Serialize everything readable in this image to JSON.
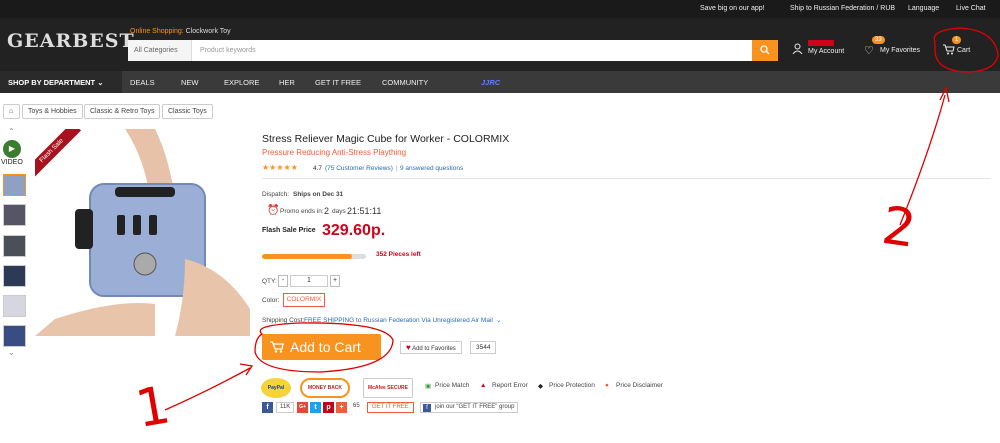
{
  "topbar": {
    "app_promo": "Save big on our app!",
    "ship_to": "Ship to Russian Federation / RUB",
    "language": "Language",
    "live_chat": "Live Chat"
  },
  "header": {
    "logo": "GEARBEST",
    "online_label": "Online Shopping:",
    "online_value": "Clockwork Toy",
    "category_select": "All Categories",
    "search_placeholder": "Product keywords",
    "account": "My Account",
    "favorites": "My Favorites",
    "favorites_count": "33",
    "cart": "Cart",
    "cart_count": "1"
  },
  "nav": {
    "department": "SHOP BY DEPARTMENT",
    "items": [
      "DEALS",
      "NEW",
      "EXPLORE",
      "HER",
      "GET IT FREE",
      "COMMUNITY"
    ],
    "brand": "JJRC"
  },
  "breadcrumb": [
    "Toys & Hobbies",
    "Classic & Retro Toys",
    "Classic Toys"
  ],
  "gallery": {
    "video_label": "VIDEO",
    "ribbon": "Flash Sale"
  },
  "product": {
    "title": "Stress Reliever Magic Cube for Worker  -  COLORMIX",
    "subtitle": "Pressure Reducing Anti-Stress Plaything",
    "rating": "4.7",
    "reviews": "(75 Customer Reviews)",
    "questions": "9 answered questions",
    "dispatch_label": "Dispatch:",
    "dispatch_value": "Ships on Dec 31",
    "promo_label": "Promo ends in:",
    "promo_days": "2",
    "promo_days_unit": "days",
    "promo_time": "21:51:11",
    "flash_label": "Flash Sale Price",
    "price": "329.60p.",
    "pieces_left": "352 Pieces left",
    "stock_fraction": 0.87,
    "qty_label": "QTY:",
    "qty_value": "1",
    "color_label": "Color:",
    "color_value": "COLORMIX",
    "shipping_label": "Shipping Cost:",
    "shipping_value": "FREE SHIPPING to Russian Federation Via Unregistered Air Mail",
    "add_to_cart": "Add to Cart",
    "add_to_favorites": "Add to Favorites",
    "favorites_count": "3544"
  },
  "trust": {
    "badges": [
      "PayPal",
      "MONEY BACK",
      "McAfee SECURE"
    ],
    "links": [
      "Price Match",
      "Report Error",
      "Price Protection",
      "Price Disclaimer"
    ]
  },
  "social": {
    "fb_count": "11K",
    "share_count": "65",
    "get_free": "GET IT FREE",
    "join_group": "join our \"GET IT FREE\" group"
  },
  "annotations": {
    "step1": "1",
    "step2": "2"
  },
  "colors": {
    "accent": "#f7931e",
    "price": "#d0021b",
    "annotation": "#e00000"
  }
}
